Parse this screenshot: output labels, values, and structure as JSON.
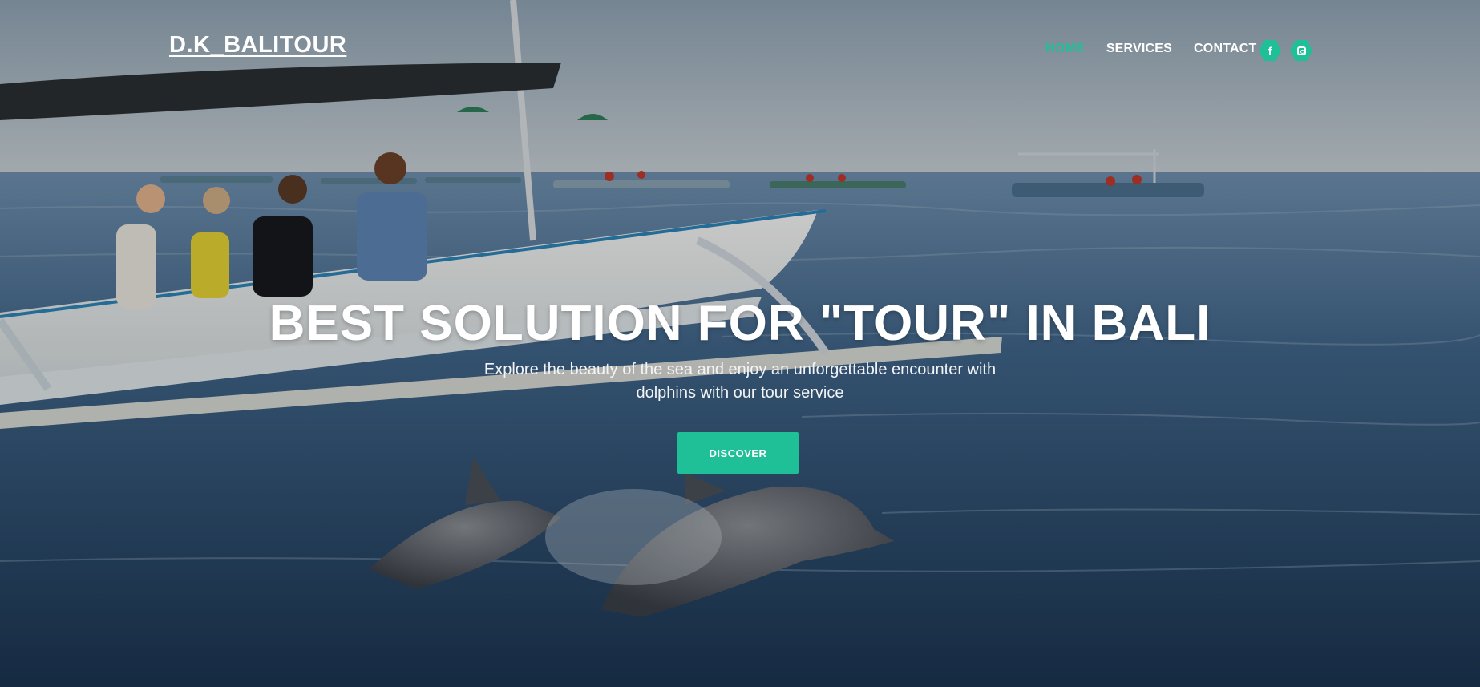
{
  "brand": {
    "logo": "D.K_BALITOUR"
  },
  "nav": {
    "items": [
      "HOME",
      "SERVICES",
      "CONTACT"
    ],
    "active": "HOME"
  },
  "social": {
    "facebook_glyph": "f",
    "icons": [
      "facebook-icon",
      "instagram-icon"
    ]
  },
  "hero": {
    "title": "BEST SOLUTION FOR \"TOUR\" IN BALI",
    "subtitle": "Explore the beauty of the sea and enjoy an unforgettable encounter with dolphins with our tour service",
    "cta_label": "DISCOVER"
  },
  "colors": {
    "accent": "#1fbf98",
    "text": "#ffffff"
  }
}
